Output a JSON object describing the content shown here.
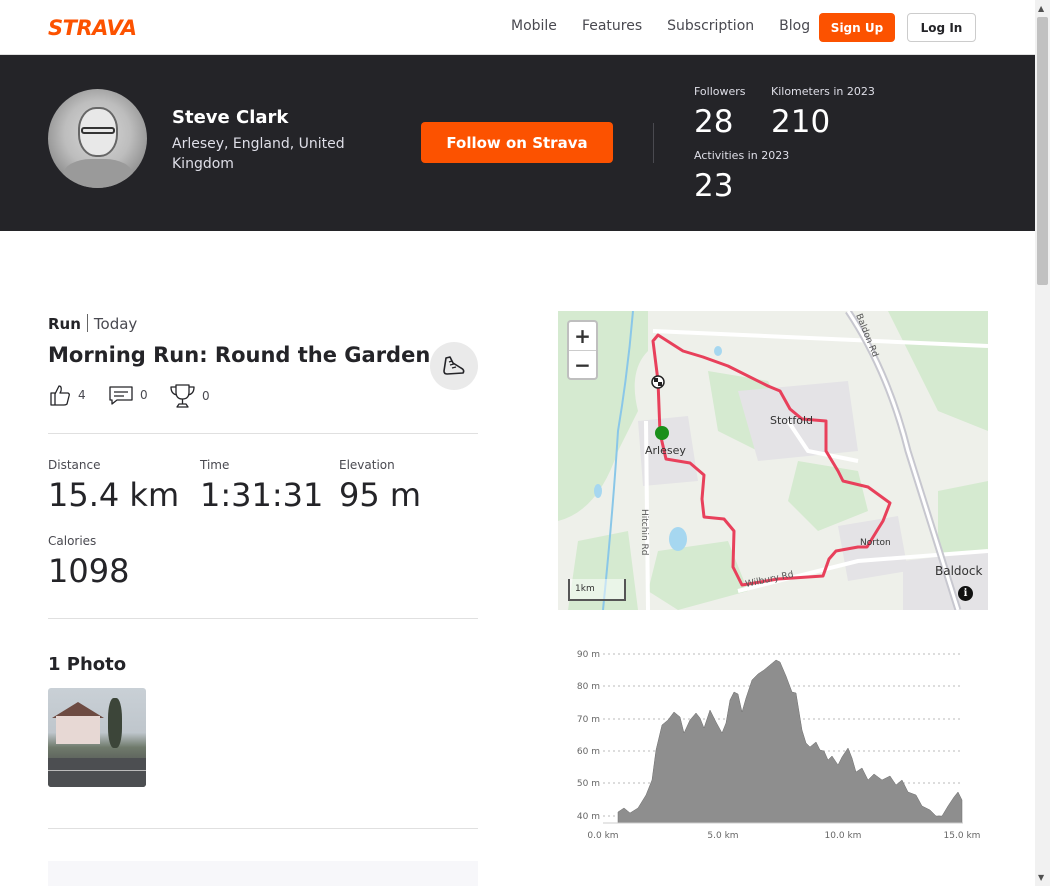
{
  "nav": {
    "logo": "STRAVA",
    "links": [
      "Mobile",
      "Features",
      "Subscription",
      "Blog"
    ],
    "signup_label": "Sign Up",
    "login_label": "Log In"
  },
  "athlete": {
    "name": "Steve Clark",
    "location": "Arlesey, England, United Kingdom",
    "follow_label": "Follow on Strava",
    "stats": {
      "followers_label": "Followers",
      "followers": "28",
      "km_label": "Kilometers in 2023",
      "km": "210",
      "activities_label": "Activities in 2023",
      "activities": "23"
    }
  },
  "activity": {
    "type": "Run",
    "when": "Today",
    "title": "Morning Run: Round the Garden",
    "kudos": "4",
    "comments": "0",
    "achievements": "0",
    "metrics": [
      {
        "label": "Distance",
        "value": "15.4 km"
      },
      {
        "label": "Time",
        "value": "1:31:31"
      },
      {
        "label": "Elevation",
        "value": "95 m"
      },
      {
        "label": "Calories",
        "value": "1098"
      }
    ],
    "photos_heading": "1 Photo"
  },
  "map": {
    "zoom_in": "+",
    "zoom_out": "−",
    "scale": "1km",
    "info": "i",
    "labels": {
      "stotfold": "Stotfold",
      "arlesey": "Arlesey",
      "norton": "Norton",
      "baldock": "Baldock",
      "hitchin_rd": "Hitchin Rd",
      "wilbury_rd": "Wilbury Rd",
      "road_ne": "Baldon Rd"
    },
    "route_color": "#e8405b"
  },
  "elevation": {
    "y_ticks": [
      "90 m",
      "80 m",
      "70 m",
      "60 m",
      "50 m",
      "40 m"
    ],
    "x_ticks": [
      "0.0 km",
      "5.0 km",
      "10.0 km",
      "15.0 km"
    ]
  },
  "colors": {
    "brand": "#fc5200",
    "banner": "#242428"
  }
}
